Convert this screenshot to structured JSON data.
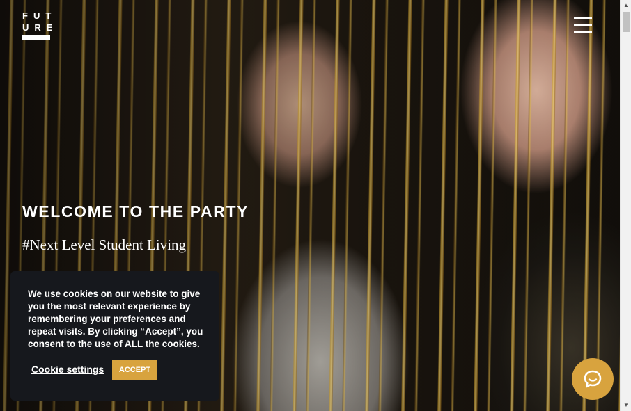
{
  "header": {
    "logo_line1": "FUT",
    "logo_line2": "URE",
    "menu_icon": "hamburger-menu-icon"
  },
  "hero": {
    "headline": "WELCOME TO THE PARTY",
    "subline": "#Next Level Student Living"
  },
  "cookie_banner": {
    "message": "We use cookies on our website to give you the most relevant experience by remembering your preferences and repeat visits. By clicking “Accept”, you consent to the use of ALL the cookies.",
    "settings_label": "Cookie settings",
    "accept_label": "ACCEPT"
  },
  "chat": {
    "icon": "chat-bubble-icon"
  },
  "colors": {
    "accent": "#d8a33e",
    "banner_bg": "#16181d",
    "text": "#ffffff"
  },
  "scrollbar": {
    "up_glyph": "▲",
    "down_glyph": "▼"
  }
}
